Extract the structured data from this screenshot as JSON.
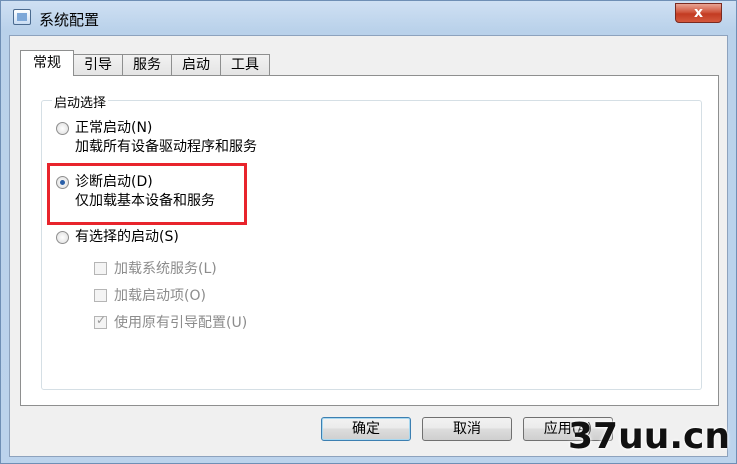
{
  "window": {
    "title": "系统配置",
    "close_label": "x"
  },
  "tabs": [
    {
      "label": "常规",
      "active": true
    },
    {
      "label": "引导",
      "active": false
    },
    {
      "label": "服务",
      "active": false
    },
    {
      "label": "启动",
      "active": false
    },
    {
      "label": "工具",
      "active": false
    }
  ],
  "startup_selection": {
    "group_title": "启动选择",
    "options": [
      {
        "label": "正常启动(N)",
        "description": "加载所有设备驱动程序和服务",
        "checked": false
      },
      {
        "label": "诊断启动(D)",
        "description": "仅加载基本设备和服务",
        "checked": true
      },
      {
        "label": "有选择的启动(S)",
        "checked": false
      }
    ],
    "selective_items": [
      {
        "label": "加载系统服务(L)",
        "checked": false,
        "enabled": false
      },
      {
        "label": "加载启动项(O)",
        "checked": false,
        "enabled": false
      },
      {
        "label": "使用原有引导配置(U)",
        "checked": true,
        "enabled": false
      }
    ]
  },
  "buttons": {
    "ok": "确定",
    "cancel": "取消",
    "apply": "应用(A)"
  },
  "watermark": "37uu.cn",
  "colors": {
    "highlight_border": "#e8242c",
    "radio_dot": "#2a5fa8"
  }
}
